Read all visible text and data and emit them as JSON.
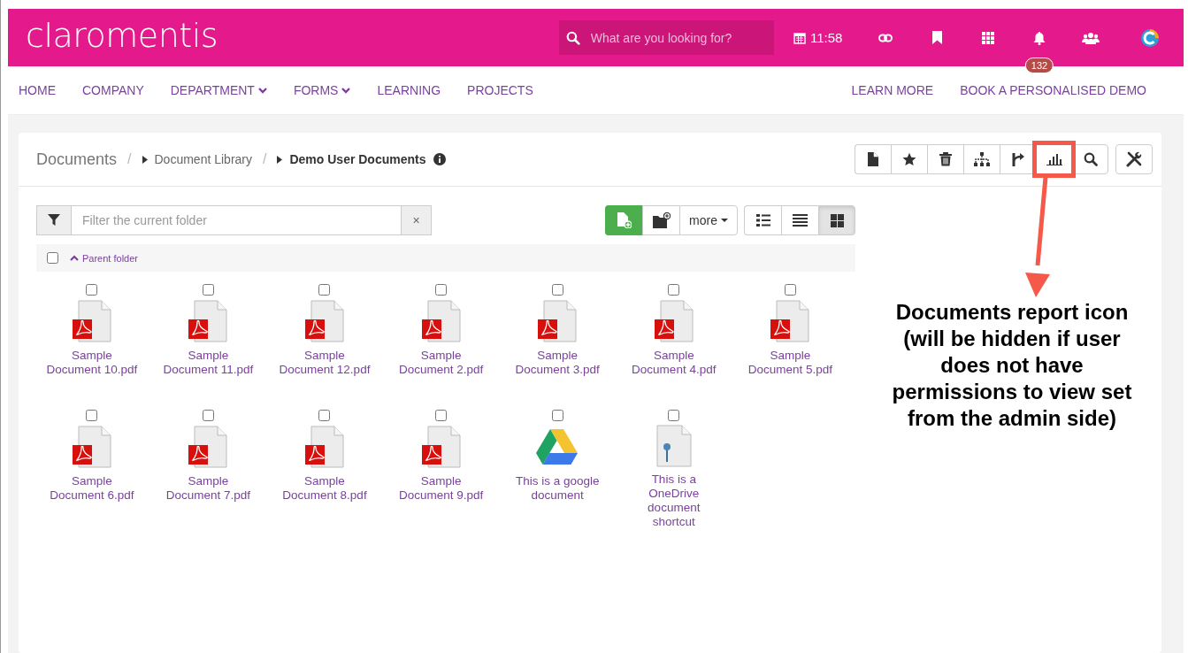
{
  "header": {
    "logo": "claromentis",
    "search": {
      "placeholder": "What are you looking for?"
    },
    "time": "11:58",
    "notifications_badge": "132"
  },
  "nav": {
    "left": [
      {
        "label": "HOME",
        "dropdown": false
      },
      {
        "label": "COMPANY",
        "dropdown": false
      },
      {
        "label": "DEPARTMENT",
        "dropdown": true
      },
      {
        "label": "FORMS",
        "dropdown": true
      },
      {
        "label": "LEARNING",
        "dropdown": false
      },
      {
        "label": "PROJECTS",
        "dropdown": false
      }
    ],
    "right": [
      "LEARN MORE",
      "BOOK A PERSONALISED DEMO"
    ]
  },
  "breadcrumb_separator": "/",
  "breadcrumb": [
    {
      "label": "Documents",
      "current": false
    },
    {
      "label": "Document Library",
      "current": false
    },
    {
      "label": "Demo User Documents",
      "current": true
    }
  ],
  "toolbar": [
    {
      "kind": "file",
      "highlighted": false
    },
    {
      "kind": "star",
      "highlighted": false
    },
    {
      "kind": "trash",
      "highlighted": false
    },
    {
      "kind": "tree",
      "highlighted": false
    },
    {
      "kind": "route",
      "highlighted": false
    },
    {
      "kind": "chart",
      "highlighted": true
    },
    {
      "kind": "search",
      "highlighted": false
    }
  ],
  "filter": {
    "placeholder": "Filter the current folder",
    "clear": "×"
  },
  "more_button": "more",
  "views": [
    {
      "kind": "details",
      "selected": false
    },
    {
      "kind": "list",
      "selected": false
    },
    {
      "kind": "grid",
      "selected": true
    }
  ],
  "parent_folder": {
    "label": "Parent folder",
    "checked": false
  },
  "files": [
    {
      "name": "Sample Document 10.pdf",
      "kind": "pdf",
      "checked": false
    },
    {
      "name": "Sample Document 11.pdf",
      "kind": "pdf",
      "checked": false
    },
    {
      "name": "Sample Document 12.pdf",
      "kind": "pdf",
      "checked": false
    },
    {
      "name": "Sample Document 2.pdf",
      "kind": "pdf",
      "checked": false
    },
    {
      "name": "Sample Document 3.pdf",
      "kind": "pdf",
      "checked": false
    },
    {
      "name": "Sample Document 4.pdf",
      "kind": "pdf",
      "checked": false
    },
    {
      "name": "Sample Document 5.pdf",
      "kind": "pdf",
      "checked": false
    },
    {
      "name": "Sample Document 6.pdf",
      "kind": "pdf",
      "checked": false
    },
    {
      "name": "Sample Document 7.pdf",
      "kind": "pdf",
      "checked": false
    },
    {
      "name": "Sample Document 8.pdf",
      "kind": "pdf",
      "checked": false
    },
    {
      "name": "Sample Document 9.pdf",
      "kind": "pdf",
      "checked": false
    },
    {
      "name": "This is a google document",
      "kind": "google-drive",
      "checked": false
    },
    {
      "name": "This is a OneDrive document shortcut",
      "kind": "onedrive",
      "checked": false
    }
  ],
  "annotation": {
    "text": "Documents report icon (will be hidden if user does not have permissions to view set from the admin side)"
  }
}
